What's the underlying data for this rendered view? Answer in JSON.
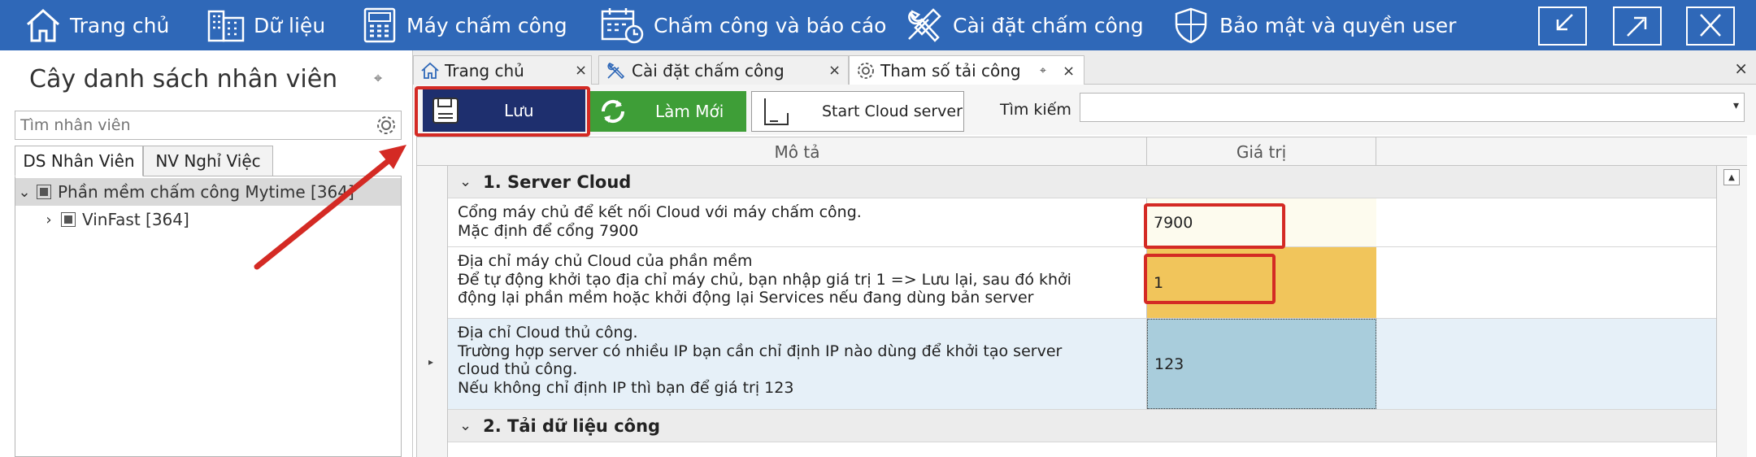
{
  "menu": {
    "home": "Trang chủ",
    "data": "Dữ liệu",
    "timeclock": "Máy chấm công",
    "attendance_report": "Chấm công và báo cáo",
    "attendance_settings": "Cài đặt chấm công",
    "security": "Bảo mật và quyền user"
  },
  "left_panel": {
    "title": "Cây danh sách nhân viên",
    "search_placeholder": "Tìm nhân viên",
    "tabs": [
      "DS Nhân Viên",
      "NV Nghỉ Việc"
    ],
    "tree": [
      {
        "label": "Phần mềm chấm công Mytime [364]"
      },
      {
        "label": "VinFast [364]"
      }
    ]
  },
  "doc_tabs": [
    "Trang chủ",
    "Cài đặt chấm công",
    "Tham số tải công"
  ],
  "toolbar": {
    "save_label": "Lưu",
    "refresh_label": "Làm Mới",
    "cloud_label": "Start Cloud server",
    "search_label": "Tìm kiếm",
    "search_value": ""
  },
  "grid": {
    "headers": {
      "description": "Mô tả",
      "value": "Giá trị"
    },
    "categories": [
      "1. Server Cloud",
      "2. Tải dữ liệu công"
    ],
    "rows": [
      {
        "lines": [
          "Cổng máy chủ để kết nối Cloud với máy chấm công.",
          "Mặc định để cổng 7900"
        ],
        "value": "7900"
      },
      {
        "lines": [
          "Địa chỉ máy chủ Cloud của phần mềm",
          "Để tự động khởi tạo địa chỉ máy chủ, bạn nhập giá trị 1 => Lưu lại, sau đó khởi",
          "động lại phần mềm hoặc khởi động lại Services nếu đang dùng bản server"
        ],
        "value": "1"
      },
      {
        "lines": [
          "Địa chỉ Cloud thủ công.",
          "Trường hợp server có nhiều IP bạn cần chỉ định IP nào dùng để khởi tạo server",
          "cloud thủ công.",
          "Nếu không chỉ định IP thì bạn để giá trị 123"
        ],
        "value": "123"
      }
    ]
  },
  "colors": {
    "menu_bar": "#2f68b8",
    "save_button": "#1e2f6e",
    "refresh_button": "#3e9e37",
    "highlight": "#d42a24",
    "value_1_bg": "#fdfbee",
    "value_2_bg": "#f1c55b",
    "value_3_bg": "#a9cddc",
    "selected_row_bg": "#e6f0f8"
  }
}
